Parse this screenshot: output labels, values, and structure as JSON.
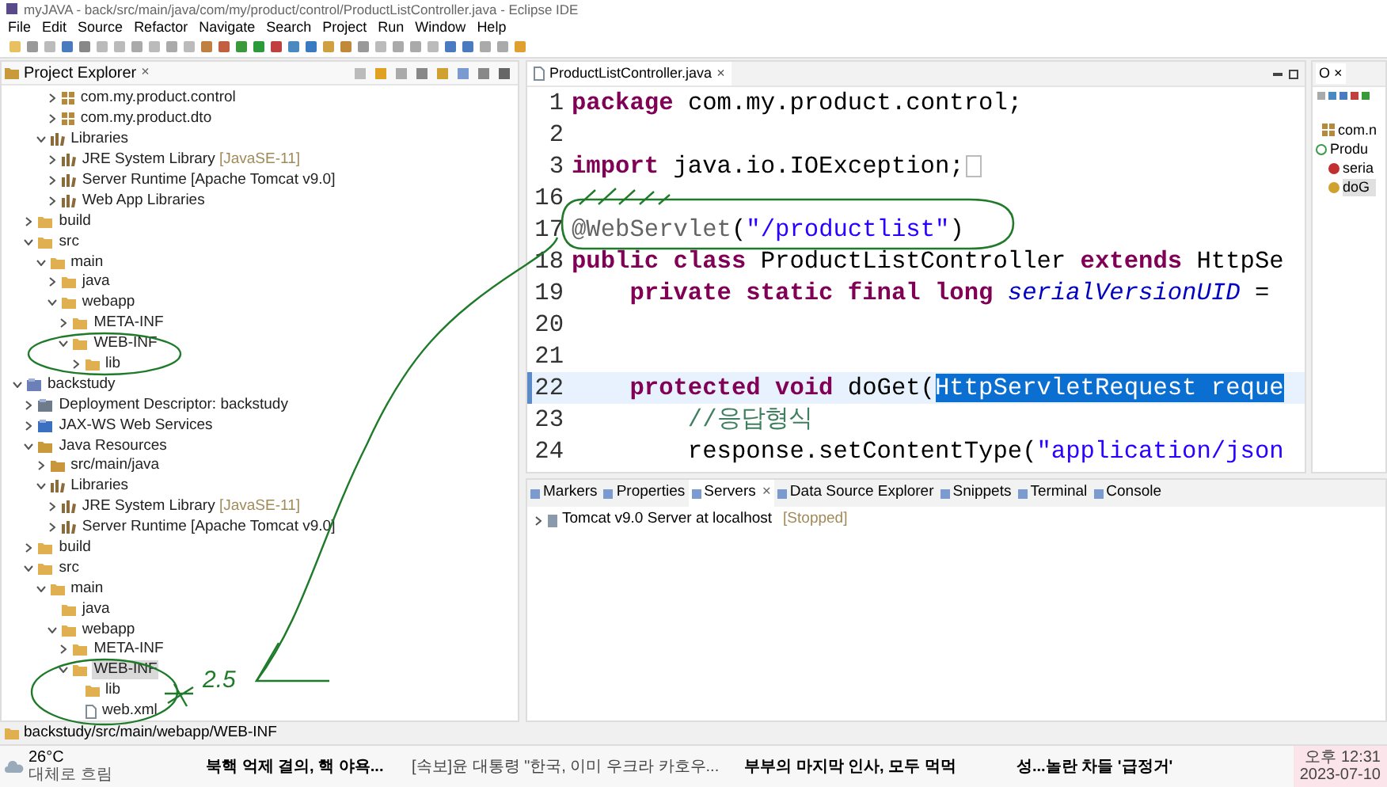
{
  "window": {
    "title": "myJAVA - back/src/main/java/com/my/product/control/ProductListController.java - Eclipse IDE"
  },
  "menu": [
    "File",
    "Edit",
    "Source",
    "Refactor",
    "Navigate",
    "Search",
    "Project",
    "Run",
    "Window",
    "Help"
  ],
  "project_explorer": {
    "title": "Project Explorer",
    "close": "×",
    "tree": [
      {
        "children": [
          {
            "children": [
              {
                "children": [
                  {
                    "label": "com.my.product.control",
                    "kind": "package",
                    "expanded": false,
                    "selected": false
                  },
                  {
                    "label": "com.my.product.dto",
                    "kind": "package",
                    "expanded": false,
                    "selected": false
                  }
                ]
              },
              {
                "label": "Libraries",
                "kind": "library",
                "expanded": true,
                "selected": false,
                "children": [
                  {
                    "label": "JRE System Library",
                    "suffix": "[JavaSE-11]",
                    "kind": "library",
                    "expanded": false,
                    "selected": false
                  },
                  {
                    "label": "Server Runtime [Apache Tomcat v9.0]",
                    "kind": "library",
                    "expanded": false,
                    "selected": false
                  },
                  {
                    "label": "Web App Libraries",
                    "kind": "library",
                    "expanded": false,
                    "selected": false
                  }
                ]
              }
            ]
          },
          {
            "label": "build",
            "kind": "folder",
            "expanded": false,
            "selected": false
          },
          {
            "label": "src",
            "kind": "folder",
            "expanded": true,
            "selected": false,
            "children": [
              {
                "label": "main",
                "kind": "folder",
                "expanded": true,
                "selected": false,
                "children": [
                  {
                    "label": "java",
                    "kind": "folder",
                    "expanded": false,
                    "selected": false
                  },
                  {
                    "label": "webapp",
                    "kind": "folder",
                    "expanded": true,
                    "selected": false,
                    "children": [
                      {
                        "label": "META-INF",
                        "kind": "folder",
                        "expanded": false,
                        "selected": false
                      },
                      {
                        "label": "WEB-INF",
                        "kind": "folder",
                        "expanded": true,
                        "selected": false,
                        "children": [
                          {
                            "label": "lib",
                            "kind": "folder",
                            "expanded": false,
                            "selected": false
                          }
                        ]
                      }
                    ]
                  }
                ]
              }
            ]
          }
        ]
      },
      {
        "label": "backstudy",
        "kind": "project",
        "expanded": true,
        "selected": false,
        "children": [
          {
            "label": "Deployment Descriptor: backstudy",
            "kind": "descriptor",
            "expanded": false,
            "selected": false
          },
          {
            "label": "JAX-WS Web Services",
            "kind": "webservices",
            "expanded": false,
            "selected": false
          },
          {
            "label": "Java Resources",
            "kind": "resources",
            "expanded": true,
            "selected": false,
            "children": [
              {
                "label": "src/main/java",
                "kind": "srcfolder",
                "expanded": false,
                "selected": false
              },
              {
                "label": "Libraries",
                "kind": "library",
                "expanded": true,
                "selected": false,
                "children": [
                  {
                    "label": "JRE System Library",
                    "suffix": "[JavaSE-11]",
                    "kind": "library",
                    "expanded": false,
                    "selected": false
                  },
                  {
                    "label": "Server Runtime [Apache Tomcat v9.0]",
                    "kind": "library",
                    "expanded": false,
                    "selected": false
                  }
                ]
              }
            ]
          },
          {
            "label": "build",
            "kind": "folder",
            "expanded": false,
            "selected": false
          },
          {
            "label": "src",
            "kind": "folder",
            "expanded": true,
            "selected": false,
            "children": [
              {
                "label": "main",
                "kind": "folder",
                "expanded": true,
                "selected": false,
                "children": [
                  {
                    "label": "java",
                    "kind": "folder",
                    "selected": false
                  },
                  {
                    "label": "webapp",
                    "kind": "folder",
                    "expanded": true,
                    "selected": false,
                    "children": [
                      {
                        "label": "META-INF",
                        "kind": "folder",
                        "expanded": false,
                        "selected": false
                      },
                      {
                        "label": "WEB-INF",
                        "kind": "folder",
                        "expanded": true,
                        "selected": true,
                        "children": [
                          {
                            "label": "lib",
                            "kind": "folder",
                            "selected": false
                          },
                          {
                            "label": "web.xml",
                            "kind": "xmlfile",
                            "selected": false
                          }
                        ]
                      }
                    ]
                  }
                ]
              }
            ]
          }
        ]
      }
    ]
  },
  "editor": {
    "tab": "ProductListController.java",
    "close": "×",
    "lines": [
      {
        "number": "1",
        "current": false,
        "collapsed": false,
        "tokens": [
          {
            "kind": "keyword",
            "text": "package"
          },
          {
            "kind": "plain",
            "text": " com.my.product.control;"
          }
        ]
      },
      {
        "number": "2",
        "current": false,
        "collapsed": false
      },
      {
        "number": "3",
        "current": false,
        "collapsed": true,
        "tokens": [
          {
            "kind": "keyword",
            "text": "import"
          },
          {
            "kind": "plain",
            "text": " java.io.IOException;"
          }
        ]
      },
      {
        "number": "16",
        "current": false,
        "collapsed": false
      },
      {
        "number": "17",
        "current": false,
        "collapsed": false,
        "tokens": [
          {
            "kind": "annotation",
            "text": "@WebServlet"
          },
          {
            "kind": "plain",
            "text": "("
          },
          {
            "kind": "string",
            "text": "\"/productlist\""
          },
          {
            "kind": "plain",
            "text": ")"
          }
        ]
      },
      {
        "number": "18",
        "current": false,
        "collapsed": false,
        "tokens": [
          {
            "kind": "keyword",
            "text": "public class"
          },
          {
            "kind": "plain",
            "text": " ProductListController "
          },
          {
            "kind": "keyword",
            "text": "extends"
          },
          {
            "kind": "plain",
            "text": " HttpSe"
          }
        ]
      },
      {
        "number": "19",
        "current": false,
        "collapsed": false,
        "tokens": [
          {
            "kind": "keyword",
            "text": "    private static final long"
          },
          {
            "kind": "field",
            "text": " serialVersionUID"
          },
          {
            "kind": "plain",
            "text": " ="
          }
        ]
      },
      {
        "number": "20",
        "current": false,
        "collapsed": false
      },
      {
        "number": "21",
        "current": false,
        "collapsed": false
      },
      {
        "number": "22",
        "current": true,
        "collapsed": false,
        "tokens": [
          {
            "kind": "keyword",
            "text": "    protected void"
          },
          {
            "kind": "plain",
            "text": " doGet("
          },
          {
            "kind": "selection",
            "text": "HttpServletRequest reque"
          }
        ]
      },
      {
        "number": "23",
        "current": false,
        "collapsed": false,
        "tokens": [
          {
            "kind": "comment",
            "text": "        //응답형식"
          }
        ]
      },
      {
        "number": "24",
        "current": false,
        "collapsed": false,
        "tokens": [
          {
            "kind": "plain",
            "text": "        response.setContentType("
          },
          {
            "kind": "string",
            "text": "\"application/json"
          }
        ]
      }
    ]
  },
  "outline": {
    "tab": "O",
    "close": "×",
    "items": [
      {
        "label": "com.n",
        "kind": "package",
        "selected": false
      },
      {
        "label": "Produ",
        "kind": "class",
        "selected": false
      },
      {
        "label": "seria",
        "kind": "field",
        "selected": false
      },
      {
        "label": "doG",
        "kind": "method",
        "selected": true
      }
    ]
  },
  "bottom_panel": {
    "tabs": [
      {
        "label": "Markers",
        "selected": false
      },
      {
        "label": "Properties",
        "selected": false
      },
      {
        "label": "Servers",
        "selected": true
      },
      {
        "label": "Data Source Explorer",
        "selected": false
      },
      {
        "label": "Snippets",
        "selected": false
      },
      {
        "label": "Terminal",
        "selected": false
      },
      {
        "label": "Console",
        "selected": false
      }
    ],
    "close": "×",
    "servers": [
      {
        "name": "Tomcat v9.0 Server at localhost",
        "status": "[Stopped]"
      }
    ]
  },
  "status_bar": "backstudy/src/main/webapp/WEB-INF",
  "annotation": {
    "note": "2.5"
  },
  "taskbar": {
    "weather": {
      "temperature": "26°C",
      "condition": "대체로 흐림"
    },
    "news": [
      "북핵 억제 결의, 핵 야욕...",
      "[속보]윤 대통령 \"한국, 이미 우크라 카호우...",
      "부부의 마지막 인사, 모두 먹먹",
      "성...놀란 차들 '급정거'"
    ],
    "time": "오후 12:31",
    "date": "2023-07-10"
  }
}
